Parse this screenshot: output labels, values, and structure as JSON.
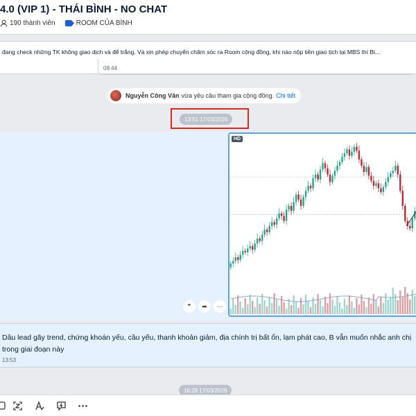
{
  "header": {
    "title": "4.0 (VIP 1) - THÁI BÌNH - NO CHAT",
    "members": "190 thành viên",
    "room_tag": "ROOM CỦA BÌNH"
  },
  "messages": {
    "m1_text": "đang check những TK không giao dịch và để trắng. Và xin phép chuyển chăm sóc ra Room cộng đồng, khi nào nộp tiền giao tịch tại MBS thì Bi...",
    "m1_time": "08:44",
    "sys_name": "Nguyễn Công Văn",
    "sys_text": "vừa yêu cầu tham gia cộng đồng.",
    "sys_link": "Chi tiết",
    "ts1": "13:51 17/03/2026",
    "hd": "HD",
    "m2_text": "Dầu lead gãy trend, chứng khoán yếu, cầu yếu, thanh khoản giảm, địa chính trị bất ổn, lạm phát cao, B vẫn muốn nhắc anh chị trong giai đoạn này",
    "m2_time": "13:53",
    "ts2": "16:29 17/03/2026"
  },
  "actions": {
    "quote": "❞",
    "share": "➦",
    "more": "···"
  },
  "colors": {
    "accent": "#0068ff",
    "up": "#2ca58d",
    "down": "#b0303c",
    "highlight_box": "#e1261c"
  },
  "chart_data": {
    "type": "candlestick",
    "closes": [
      50,
      52,
      55,
      53,
      57,
      60,
      59,
      62,
      64,
      61,
      66,
      70,
      68,
      73,
      77,
      75,
      80,
      83,
      81,
      86,
      90,
      88,
      84,
      93,
      96,
      92,
      99,
      105,
      101,
      96,
      103,
      108,
      112,
      110,
      118,
      121,
      117,
      125,
      130,
      126,
      121,
      115,
      120,
      124,
      128,
      131,
      135,
      138,
      141,
      136,
      139,
      143,
      140,
      133,
      128,
      123,
      127,
      120,
      116,
      112,
      114,
      110,
      107,
      111,
      115,
      119,
      122,
      124,
      128,
      121,
      108,
      96,
      84,
      80,
      78,
      86,
      92,
      88,
      95
    ]
  }
}
